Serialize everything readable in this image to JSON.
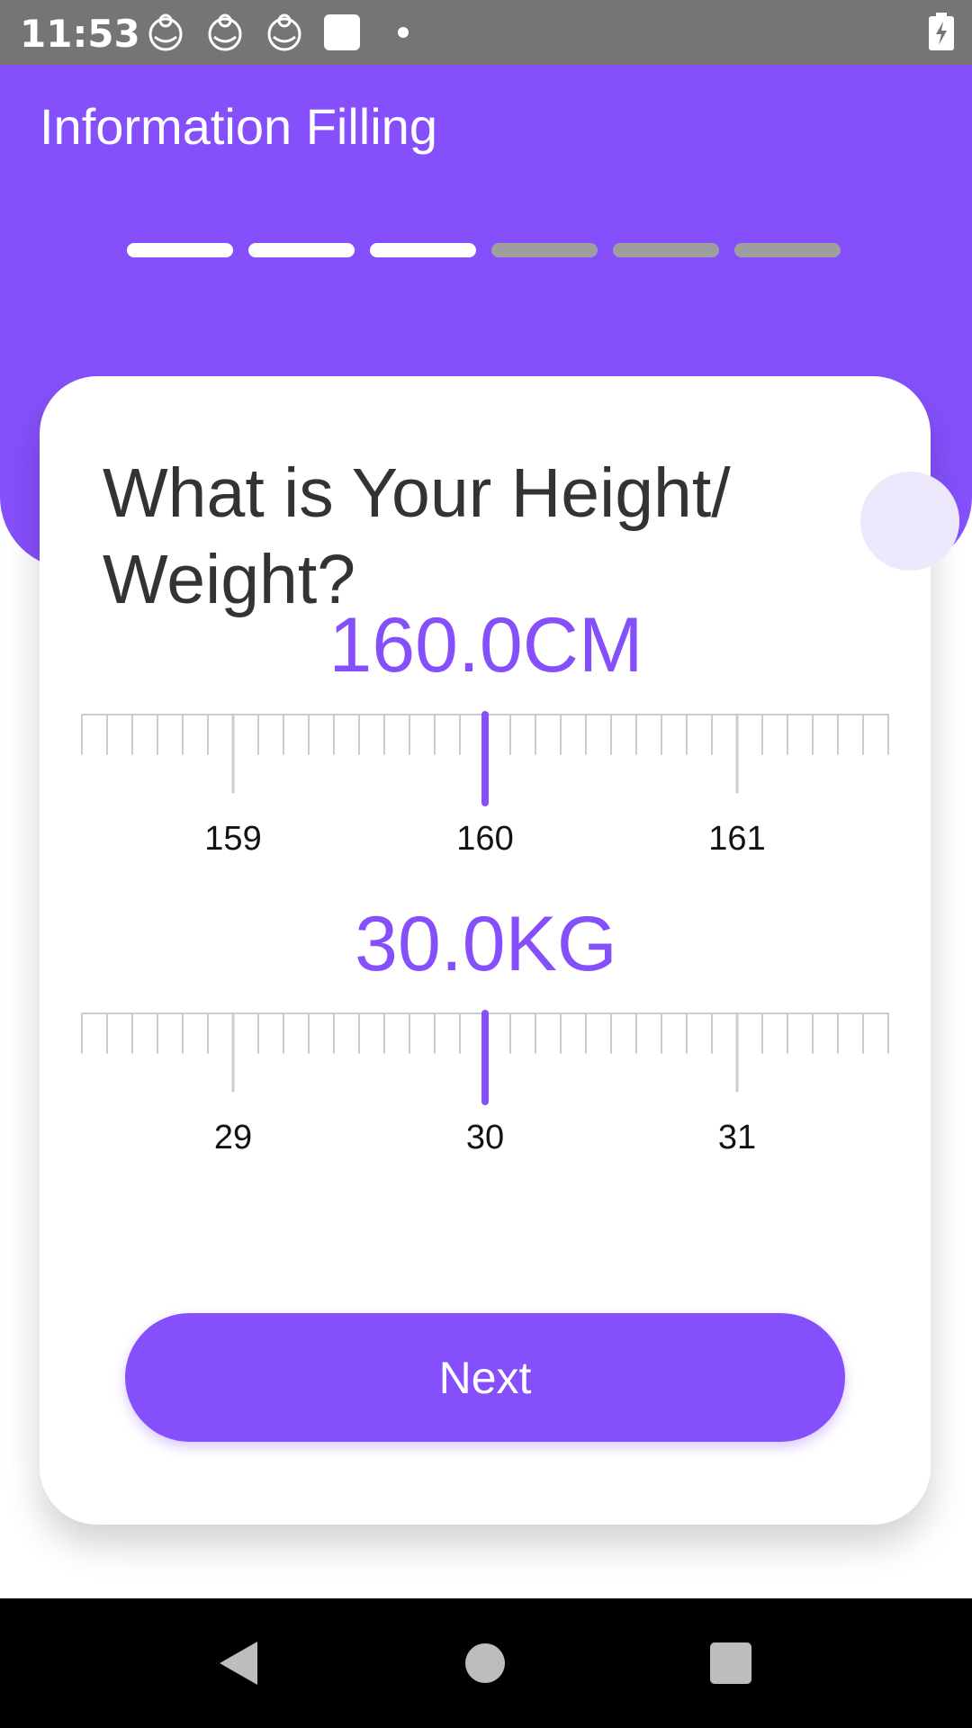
{
  "status_bar": {
    "time": "11:53",
    "notification_icons": [
      "baby-app-icon",
      "baby-app-icon",
      "baby-app-icon",
      "white-square-icon",
      "dot-icon"
    ],
    "battery": "battery-charging-icon"
  },
  "header": {
    "title": "Information Filling",
    "progress": {
      "total_steps": 6,
      "completed_steps": 3
    }
  },
  "card": {
    "question": "What is Your Height/ Weight?",
    "height": {
      "value_text": "160.0CM",
      "selected": 160,
      "tick_labels": [
        "159",
        "160",
        "161"
      ]
    },
    "weight": {
      "value_text": "30.0KG",
      "selected": 30,
      "tick_labels": [
        "29",
        "30",
        "31"
      ]
    },
    "next_label": "Next"
  },
  "nav_bar": {
    "buttons": [
      "back-icon",
      "home-icon",
      "recents-icon"
    ]
  },
  "colors": {
    "accent": "#8550FC",
    "progress_done": "#FFFFFF",
    "progress_todo": "#9E9E9E",
    "tick": "#CCCCCC",
    "text_dark": "#333333"
  }
}
